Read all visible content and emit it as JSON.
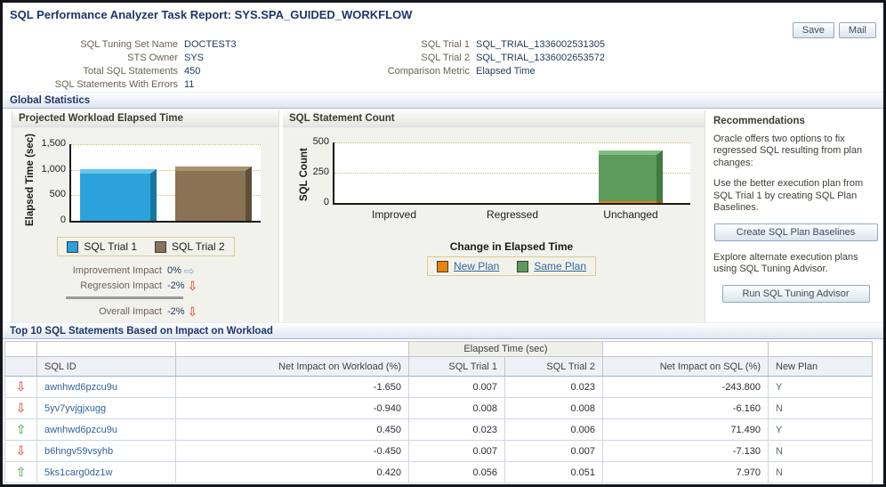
{
  "page": {
    "title": "SQL Performance Analyzer Task Report: SYS.SPA_GUIDED_WORKFLOW"
  },
  "toolbar": {
    "save_label": "Save",
    "mail_label": "Mail"
  },
  "colors": {
    "accent": "#1f3668",
    "link": "#31659c",
    "negative_arrow": "#d93511",
    "positive_arrow": "#2f9e33",
    "neutral_arrow": "#8fa8d8"
  },
  "summary": {
    "left": [
      {
        "label": "SQL Tuning Set Name",
        "value": "DOCTEST3"
      },
      {
        "label": "STS Owner",
        "value": "SYS"
      },
      {
        "label": "Total SQL Statements",
        "value": "450"
      },
      {
        "label": "SQL Statements With Errors",
        "value": "11"
      }
    ],
    "right": [
      {
        "label": "SQL Trial 1",
        "value": "SQL_TRIAL_1336002531305"
      },
      {
        "label": "SQL Trial 2",
        "value": "SQL_TRIAL_1336002653572"
      },
      {
        "label": "Comparison Metric",
        "value": "Elapsed Time"
      }
    ]
  },
  "global_statistics": {
    "heading": "Global Statistics",
    "impacts": [
      {
        "label": "Improvement Impact",
        "value": "0%",
        "direction": "flat"
      },
      {
        "label": "Regression Impact",
        "value": "-2%",
        "direction": "down"
      },
      {
        "label": "Overall Impact",
        "value": "-2%",
        "direction": "down"
      }
    ],
    "recommendations": {
      "heading": "Recommendations",
      "p1": "Oracle offers two options to fix regressed SQL resulting from plan changes:",
      "p2": "Use the better execution plan from SQL Trial 1 by creating SQL Plan Baselines.",
      "button1": "Create SQL Plan Baselines",
      "p3": "Explore alternate execution plans using SQL Tuning Advisor.",
      "button2": "Run SQL Tuning Advisor"
    }
  },
  "chart_data": [
    {
      "type": "bar",
      "title": "Projected Workload Elapsed Time",
      "ylabel": "Elapsed Time (sec)",
      "categories": [
        "SQL Trial 1",
        "SQL Trial 2"
      ],
      "values": [
        1010,
        1065
      ],
      "ylim": [
        0,
        1500
      ],
      "yticks": [
        0,
        500,
        1000,
        1500
      ],
      "ytick_labels": [
        "0",
        "500",
        "1,000",
        "1,500"
      ],
      "grid": "dotted-horizontal",
      "legend_position": "bottom",
      "colors": [
        {
          "front": "#2ba2db",
          "top": "#66c6ec",
          "side": "#17769f"
        },
        {
          "front": "#8a7254",
          "top": "#a8916e",
          "side": "#5f4e38"
        }
      ]
    },
    {
      "type": "stacked-bar",
      "title": "SQL Statement Count",
      "ylabel": "SQL Count",
      "xlabel": "Change in Elapsed Time",
      "categories": [
        "Improved",
        "Regressed",
        "Unchanged"
      ],
      "series": [
        {
          "name": "New Plan",
          "values": [
            0,
            0,
            10
          ],
          "color": {
            "front": "#e8820c",
            "top": "#f3a54a",
            "side": "#a85c05"
          }
        },
        {
          "name": "Same Plan",
          "values": [
            0,
            0,
            420
          ],
          "color": {
            "front": "#5c9b5c",
            "top": "#84bd84",
            "side": "#3f7a3e"
          }
        }
      ],
      "ylim": [
        0,
        500
      ],
      "yticks": [
        0,
        250,
        500
      ],
      "ytick_labels": [
        "0",
        "250",
        "500"
      ],
      "grid": "dotted-horizontal",
      "legend_position": "bottom",
      "legend_links": true
    }
  ],
  "table": {
    "heading": "Top 10 SQL Statements Based on Impact on Workload",
    "group_header": "Elapsed Time (sec)",
    "columns": [
      "SQL ID",
      "Net Impact on Workload (%)",
      "SQL Trial 1",
      "SQL Trial 2",
      "Net Impact on SQL (%)",
      "New Plan"
    ],
    "rows": [
      {
        "trend": "down",
        "sql_id": "awnhwd6pzcu9u",
        "net_workload": "-1.650",
        "trial1": "0.007",
        "trial2": "0.023",
        "net_sql": "-243.800",
        "new_plan": "Y"
      },
      {
        "trend": "down",
        "sql_id": "5yv7yvjgjxugg",
        "net_workload": "-0.940",
        "trial1": "0.008",
        "trial2": "0.008",
        "net_sql": "-6.160",
        "new_plan": "N"
      },
      {
        "trend": "up",
        "sql_id": "awnhwd6pzcu9u",
        "net_workload": "0.450",
        "trial1": "0.023",
        "trial2": "0.006",
        "net_sql": "71.490",
        "new_plan": "Y"
      },
      {
        "trend": "down",
        "sql_id": "b6hngv59vsyhb",
        "net_workload": "-0.450",
        "trial1": "0.007",
        "trial2": "0.007",
        "net_sql": "-7.130",
        "new_plan": "N"
      },
      {
        "trend": "up",
        "sql_id": "5ks1carg0dz1w",
        "net_workload": "0.420",
        "trial1": "0.056",
        "trial2": "0.051",
        "net_sql": "7.970",
        "new_plan": "N"
      }
    ]
  }
}
